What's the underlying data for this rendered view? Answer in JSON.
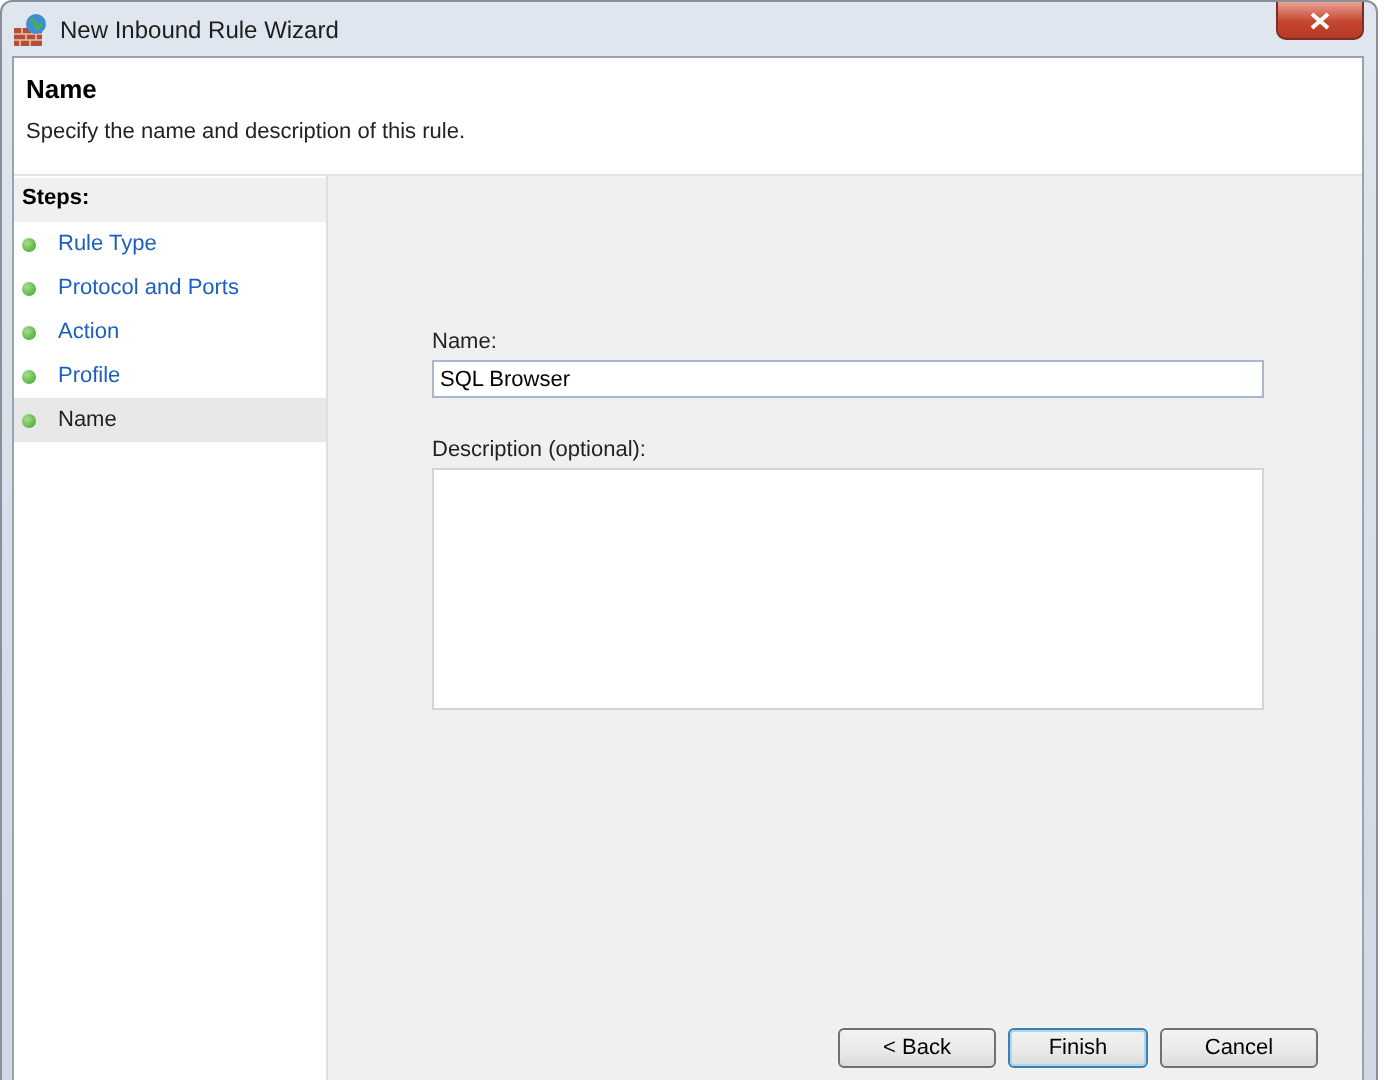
{
  "window": {
    "title": "New Inbound Rule Wizard"
  },
  "header": {
    "title": "Name",
    "subtitle": "Specify the name and description of this rule."
  },
  "steps": {
    "heading": "Steps:",
    "items": [
      {
        "label": "Rule Type",
        "selected": false
      },
      {
        "label": "Protocol and Ports",
        "selected": false
      },
      {
        "label": "Action",
        "selected": false
      },
      {
        "label": "Profile",
        "selected": false
      },
      {
        "label": "Name",
        "selected": true
      }
    ]
  },
  "form": {
    "name_label": "Name:",
    "name_value": "SQL Browser",
    "description_label": "Description (optional):"
  },
  "buttons": [
    {
      "label": "< Back",
      "default": false
    },
    {
      "label": "Finish",
      "default": true
    },
    {
      "label": "Cancel",
      "default": false
    }
  ]
}
